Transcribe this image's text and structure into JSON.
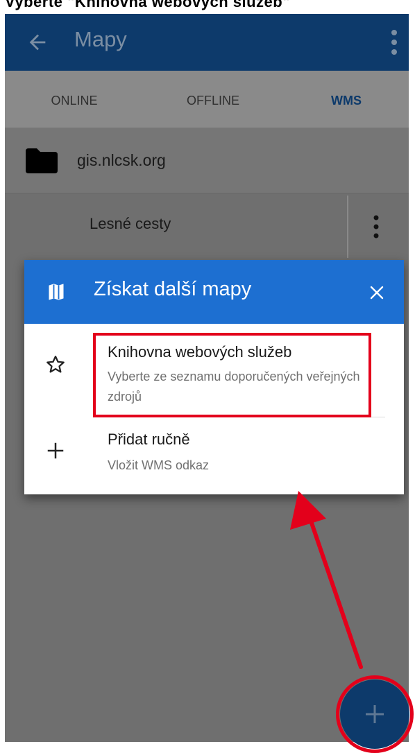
{
  "caption": {
    "text": "Vyberte \"Knihovna webových služeb\""
  },
  "appbar": {
    "back_icon": "arrow-left-icon",
    "title": "Mapy",
    "more_icon": "more-vert-icon"
  },
  "tabs": [
    {
      "label": "ONLINE",
      "selected": false
    },
    {
      "label": "OFFLINE",
      "selected": false
    },
    {
      "label": "WMS",
      "selected": true
    }
  ],
  "list": {
    "folder": {
      "icon": "folder-icon",
      "label": "gis.nlcsk.org"
    },
    "map_item": {
      "label": "Lesné cesty",
      "more_icon": "more-vert-icon"
    }
  },
  "dialog": {
    "icon": "map-icon",
    "title": "Získat další mapy",
    "close_icon": "close-icon",
    "options": [
      {
        "icon": "star-outline-icon",
        "title": "Knihovna webových služeb",
        "subtitle": "Vyberte ze seznamu doporučených veřejných zdrojů"
      },
      {
        "icon": "plus-icon",
        "title": "Přidat ručně",
        "subtitle": "Vložit WMS odkaz"
      }
    ]
  },
  "fab": {
    "icon": "plus-icon"
  },
  "colors": {
    "appbar": "#0d3a6b",
    "dialog_header": "#1d6fd1",
    "annotation": "#e3001b",
    "overlay": "#6f6f6f"
  }
}
